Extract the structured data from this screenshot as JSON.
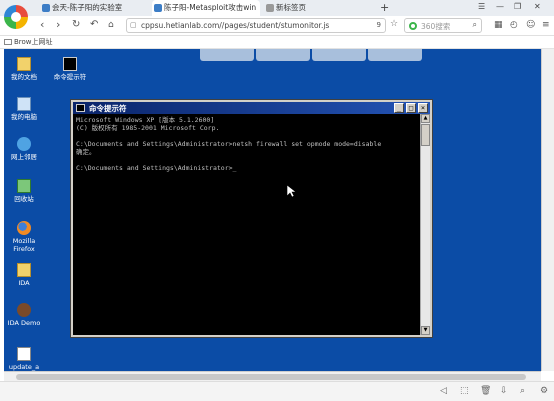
{
  "browser": {
    "tabs": [
      {
        "label": "会天-陈子阳的实验室"
      },
      {
        "label": "陈子阳-Metasploit攻击win"
      },
      {
        "label": "新标签页"
      }
    ],
    "new_tab": "+",
    "url": "cppsu.hetianlab.com//pages/student/stumonitor.js",
    "url_suffix": "9",
    "search_placeholder": "360搜索",
    "bookmark": "Brow上网址"
  },
  "desktop": {
    "icons": [
      {
        "label": "我的文档"
      },
      {
        "label": "命令提示符"
      },
      {
        "label": "我的电脑"
      },
      {
        "label": "网上邻居"
      },
      {
        "label": "回收站"
      },
      {
        "label": "Mozilla Firefox"
      },
      {
        "label": "IDA"
      },
      {
        "label": "IDA Demo"
      },
      {
        "label": "update_a"
      }
    ]
  },
  "cmd": {
    "title": "命令提示符",
    "lines": [
      "Microsoft Windows XP [版本 5.1.2600]",
      "(C) 版权所有 1985-2001 Microsoft Corp.",
      "",
      "C:\\Documents and Settings\\Administrator>netsh firewall set opmode mode=disable",
      "确定。",
      "",
      "C:\\Documents and Settings\\Administrator>_"
    ]
  },
  "colors": {
    "desktop_bg": "#0b4ca6",
    "titlebar": "#0a246a"
  }
}
